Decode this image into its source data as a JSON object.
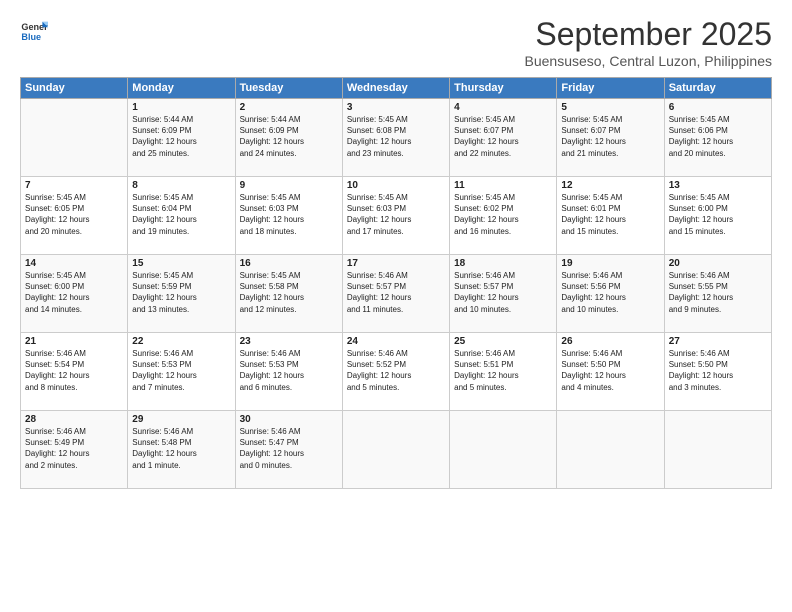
{
  "logo": {
    "line1": "General",
    "line2": "Blue"
  },
  "title": "September 2025",
  "subtitle": "Buensuseso, Central Luzon, Philippines",
  "weekdays": [
    "Sunday",
    "Monday",
    "Tuesday",
    "Wednesday",
    "Thursday",
    "Friday",
    "Saturday"
  ],
  "weeks": [
    [
      {
        "day": "",
        "info": ""
      },
      {
        "day": "1",
        "info": "Sunrise: 5:44 AM\nSunset: 6:09 PM\nDaylight: 12 hours\nand 25 minutes."
      },
      {
        "day": "2",
        "info": "Sunrise: 5:44 AM\nSunset: 6:09 PM\nDaylight: 12 hours\nand 24 minutes."
      },
      {
        "day": "3",
        "info": "Sunrise: 5:45 AM\nSunset: 6:08 PM\nDaylight: 12 hours\nand 23 minutes."
      },
      {
        "day": "4",
        "info": "Sunrise: 5:45 AM\nSunset: 6:07 PM\nDaylight: 12 hours\nand 22 minutes."
      },
      {
        "day": "5",
        "info": "Sunrise: 5:45 AM\nSunset: 6:07 PM\nDaylight: 12 hours\nand 21 minutes."
      },
      {
        "day": "6",
        "info": "Sunrise: 5:45 AM\nSunset: 6:06 PM\nDaylight: 12 hours\nand 20 minutes."
      }
    ],
    [
      {
        "day": "7",
        "info": "Sunrise: 5:45 AM\nSunset: 6:05 PM\nDaylight: 12 hours\nand 20 minutes."
      },
      {
        "day": "8",
        "info": "Sunrise: 5:45 AM\nSunset: 6:04 PM\nDaylight: 12 hours\nand 19 minutes."
      },
      {
        "day": "9",
        "info": "Sunrise: 5:45 AM\nSunset: 6:03 PM\nDaylight: 12 hours\nand 18 minutes."
      },
      {
        "day": "10",
        "info": "Sunrise: 5:45 AM\nSunset: 6:03 PM\nDaylight: 12 hours\nand 17 minutes."
      },
      {
        "day": "11",
        "info": "Sunrise: 5:45 AM\nSunset: 6:02 PM\nDaylight: 12 hours\nand 16 minutes."
      },
      {
        "day": "12",
        "info": "Sunrise: 5:45 AM\nSunset: 6:01 PM\nDaylight: 12 hours\nand 15 minutes."
      },
      {
        "day": "13",
        "info": "Sunrise: 5:45 AM\nSunset: 6:00 PM\nDaylight: 12 hours\nand 15 minutes."
      }
    ],
    [
      {
        "day": "14",
        "info": "Sunrise: 5:45 AM\nSunset: 6:00 PM\nDaylight: 12 hours\nand 14 minutes."
      },
      {
        "day": "15",
        "info": "Sunrise: 5:45 AM\nSunset: 5:59 PM\nDaylight: 12 hours\nand 13 minutes."
      },
      {
        "day": "16",
        "info": "Sunrise: 5:45 AM\nSunset: 5:58 PM\nDaylight: 12 hours\nand 12 minutes."
      },
      {
        "day": "17",
        "info": "Sunrise: 5:46 AM\nSunset: 5:57 PM\nDaylight: 12 hours\nand 11 minutes."
      },
      {
        "day": "18",
        "info": "Sunrise: 5:46 AM\nSunset: 5:57 PM\nDaylight: 12 hours\nand 10 minutes."
      },
      {
        "day": "19",
        "info": "Sunrise: 5:46 AM\nSunset: 5:56 PM\nDaylight: 12 hours\nand 10 minutes."
      },
      {
        "day": "20",
        "info": "Sunrise: 5:46 AM\nSunset: 5:55 PM\nDaylight: 12 hours\nand 9 minutes."
      }
    ],
    [
      {
        "day": "21",
        "info": "Sunrise: 5:46 AM\nSunset: 5:54 PM\nDaylight: 12 hours\nand 8 minutes."
      },
      {
        "day": "22",
        "info": "Sunrise: 5:46 AM\nSunset: 5:53 PM\nDaylight: 12 hours\nand 7 minutes."
      },
      {
        "day": "23",
        "info": "Sunrise: 5:46 AM\nSunset: 5:53 PM\nDaylight: 12 hours\nand 6 minutes."
      },
      {
        "day": "24",
        "info": "Sunrise: 5:46 AM\nSunset: 5:52 PM\nDaylight: 12 hours\nand 5 minutes."
      },
      {
        "day": "25",
        "info": "Sunrise: 5:46 AM\nSunset: 5:51 PM\nDaylight: 12 hours\nand 5 minutes."
      },
      {
        "day": "26",
        "info": "Sunrise: 5:46 AM\nSunset: 5:50 PM\nDaylight: 12 hours\nand 4 minutes."
      },
      {
        "day": "27",
        "info": "Sunrise: 5:46 AM\nSunset: 5:50 PM\nDaylight: 12 hours\nand 3 minutes."
      }
    ],
    [
      {
        "day": "28",
        "info": "Sunrise: 5:46 AM\nSunset: 5:49 PM\nDaylight: 12 hours\nand 2 minutes."
      },
      {
        "day": "29",
        "info": "Sunrise: 5:46 AM\nSunset: 5:48 PM\nDaylight: 12 hours\nand 1 minute."
      },
      {
        "day": "30",
        "info": "Sunrise: 5:46 AM\nSunset: 5:47 PM\nDaylight: 12 hours\nand 0 minutes."
      },
      {
        "day": "",
        "info": ""
      },
      {
        "day": "",
        "info": ""
      },
      {
        "day": "",
        "info": ""
      },
      {
        "day": "",
        "info": ""
      }
    ]
  ]
}
